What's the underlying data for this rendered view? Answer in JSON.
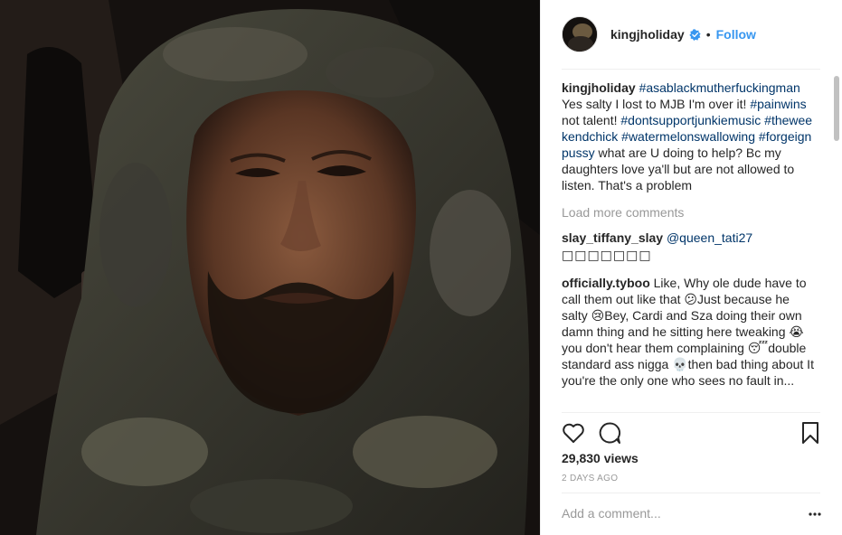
{
  "post": {
    "username": "kingjholiday",
    "follow_label": "Follow",
    "separator": "•",
    "views": "29,830 views",
    "age": "2 DAYS AGO",
    "add_comment_placeholder": "Add a comment..."
  },
  "caption": {
    "username": "kingjholiday",
    "hashtag_1": "#asablackmutherfuckingman",
    "text_1": " Yes salty I lost to MJB I'm over it! ",
    "hashtag_2": "#painwins",
    "text_2": " not talent! ",
    "hashtag_3": "#dontsupportjunkiemusic",
    "hashtag_4": "#theweekendchick",
    "hashtag_5": "#watermelonswallowing",
    "hashtag_6": "#forgeignpussy",
    "text_3": " what are U doing to help? Bc my daughters love ya'll but are not allowed to listen. That's a problem"
  },
  "load_more_label": "Load more comments",
  "comments": [
    {
      "username": "slay_tiffany_slay",
      "mention": "@queen_tati27",
      "text": " □□□□□□□"
    },
    {
      "username": "officially.tyboo",
      "text": " Like, Why ole dude have to call them out like that 😕Just because he salty 😢Bey, Cardi and Sza doing their own damn thing and he sitting here tweaking 😭you don't hear them complaining 😴double standard ass nigga 💀then bad thing about It you're the only one who sees no fault in..."
    }
  ],
  "icons": {
    "verified": "verified-badge-icon",
    "like": "heart-icon",
    "comment": "comment-bubble-icon",
    "save": "bookmark-icon",
    "more": "more-dots-icon"
  },
  "colors": {
    "link_blue": "#3897f0",
    "hashtag": "#003569",
    "muted": "#999999",
    "text": "#262626"
  }
}
